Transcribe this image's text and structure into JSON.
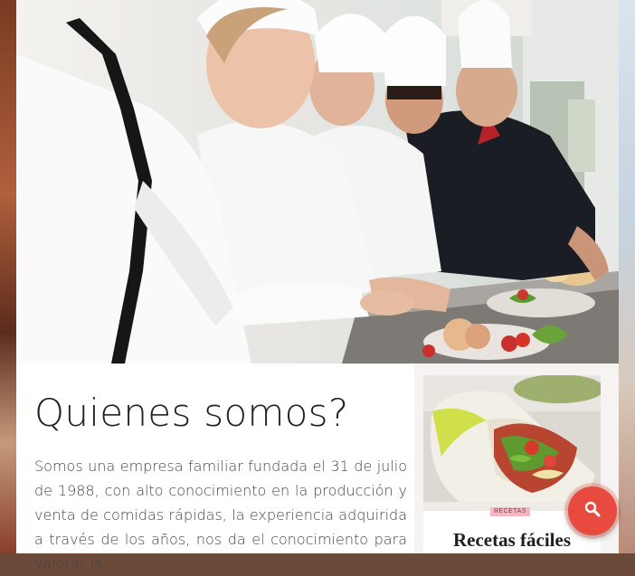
{
  "about": {
    "title": "Quienes somos?",
    "body": "Somos una empresa familiar fundada el 31 de julio de 1988, con alto conocimiento en la producción y venta de comidas rápidas, la experiencia adquirida a través de los años, nos da el conocimiento para valorar la"
  },
  "sidebar": {
    "recipe": {
      "tag": "RECETAS",
      "title": "Recetas fáciles"
    }
  },
  "search_button": {
    "icon": "search-icon"
  },
  "colors": {
    "accent": "#e84a3f",
    "tag_background": "#f3b8c0",
    "title_text": "#222222",
    "body_text": "#444444"
  }
}
